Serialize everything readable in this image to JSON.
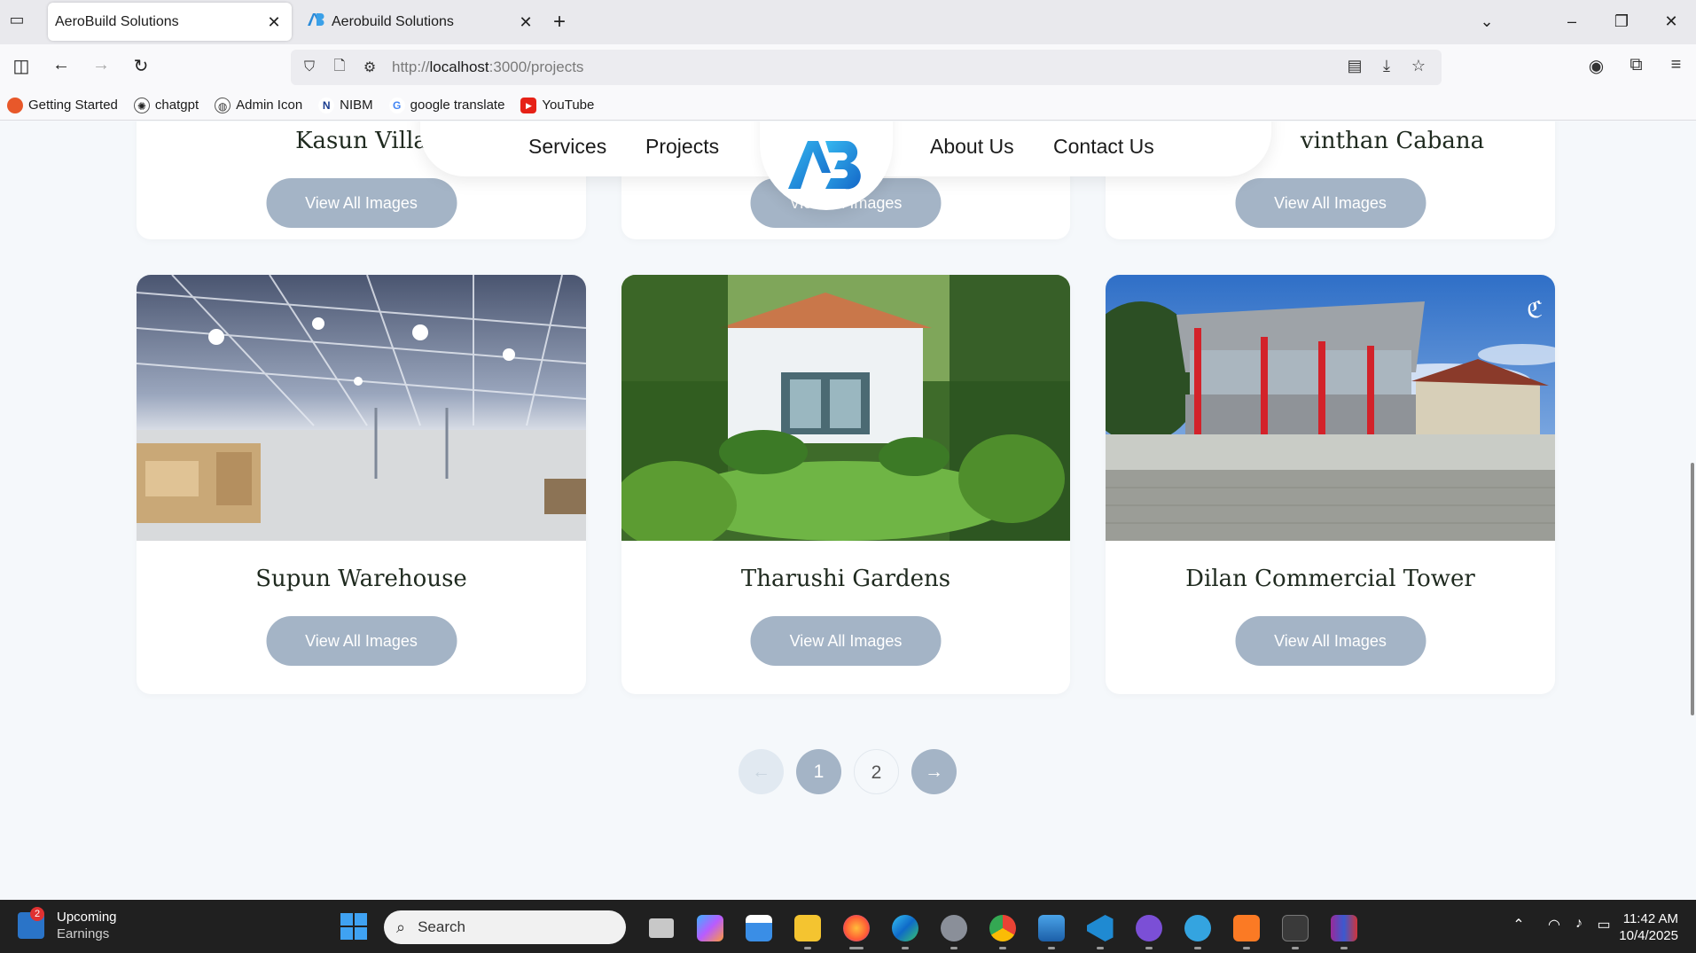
{
  "browser": {
    "tabs": [
      {
        "title": "AeroBuild Solutions",
        "active": true
      },
      {
        "title": "Aerobuild Solutions",
        "active": false
      }
    ],
    "url_prefix": "http://",
    "url_host": "localhost",
    "url_path": ":3000/projects",
    "bookmarks": [
      {
        "label": "Getting Started",
        "icon": "firefox-icon"
      },
      {
        "label": "chatgpt",
        "icon": "chatgpt-icon"
      },
      {
        "label": "Admin Icon",
        "icon": "globe-icon"
      },
      {
        "label": "NIBM",
        "icon": "nibm-icon"
      },
      {
        "label": "google translate",
        "icon": "google-icon"
      },
      {
        "label": "YouTube",
        "icon": "youtube-icon"
      }
    ]
  },
  "site": {
    "nav": {
      "services": "Services",
      "projects": "Projects",
      "about": "About Us",
      "contact": "Contact Us",
      "logo_text": "AB"
    },
    "top_cards": [
      {
        "title": "Kasun Villa",
        "button": "View All Images"
      },
      {
        "title": "",
        "button": "View All Images"
      },
      {
        "title": "vinthan Cabana",
        "button": "View All Images"
      }
    ],
    "cards": [
      {
        "title": "Supun Warehouse",
        "button": "View All Images"
      },
      {
        "title": "Tharushi Gardens",
        "button": "View All Images"
      },
      {
        "title": "Dilan Commercial Tower",
        "button": "View All Images"
      }
    ],
    "pagination": {
      "prev": "←",
      "pages": [
        "1",
        "2"
      ],
      "next": "→",
      "current": 1
    }
  },
  "taskbar": {
    "weather_title": "Upcoming",
    "weather_sub": "Earnings",
    "weather_badge": "2",
    "search_placeholder": "Search",
    "time": "11:42 AM",
    "date": "10/4/2025"
  }
}
